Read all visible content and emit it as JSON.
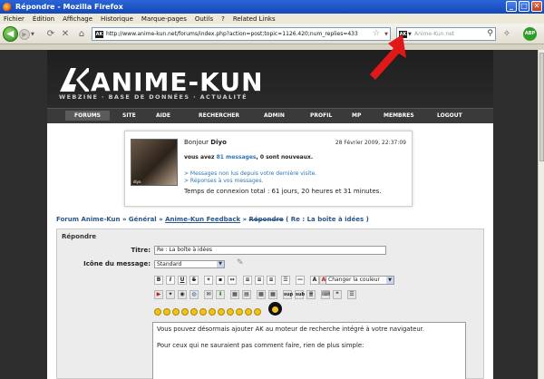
{
  "window": {
    "title": "Répondre - Mozilla Firefox",
    "menu": [
      "Fichier",
      "Édition",
      "Affichage",
      "Historique",
      "Marque-pages",
      "Outils",
      "?",
      "Related Links"
    ]
  },
  "browser": {
    "url": "http://www.anime-kun.net/forums/index.php?action=post;topic=1126.420;num_replies=433",
    "search_placeholder": "Anime-Kun.net",
    "abp_label": "ABP"
  },
  "site": {
    "logo_title": "ANIME-KUN",
    "logo_tagline": "WEBZINE · BASE DE DONNÉES · ACTUALITÉ",
    "nav": [
      "FORUMS",
      "SITE",
      "AIDE",
      "RECHERCHER",
      "ADMIN",
      "PROFIL",
      "MP",
      "MEMBRES",
      "LOGOUT"
    ]
  },
  "welcome": {
    "greeting": "Bonjour ",
    "username": "Diyo",
    "date": "28 Février 2009, 22:37:09",
    "messages_prefix": "vous avez ",
    "messages_count": "81 messages",
    "messages_suffix": ", 0 sont nouveaux.",
    "link_unread": "> Messages non lus depuis votre dernière visite.",
    "link_replies": "> Réponses à vos messages.",
    "connection_time": "Temps de connexion total : 61 jours, 20 heures et 31 minutes.",
    "avatar_caption": "diyo"
  },
  "breadcrumb": {
    "forum": "Forum Anime-Kun",
    "general": "Général",
    "feedback": "Anime-Kun Feedback",
    "reply": "Répondre",
    "topic": " ( Re : La boîte à idées )"
  },
  "form": {
    "header": "Répondre",
    "title_label": "Titre:",
    "title_value": "Re : La boîte à idées",
    "icon_label": "Icône du message:",
    "icon_value": "Standard",
    "color_value": "Changer la couleur",
    "message_line1": "Vous pouvez désormais ajouter AK au moteur de recherche intégré à votre navigateur.",
    "message_line2": "Pour ceux qui ne sauraient pas comment faire, rien de plus simple:"
  },
  "colors": {
    "header_bg": "#1f1f1f",
    "link_blue": "#2a76b8",
    "breadcrumb_blue": "#2a5688",
    "arrow_red": "#e01818"
  }
}
